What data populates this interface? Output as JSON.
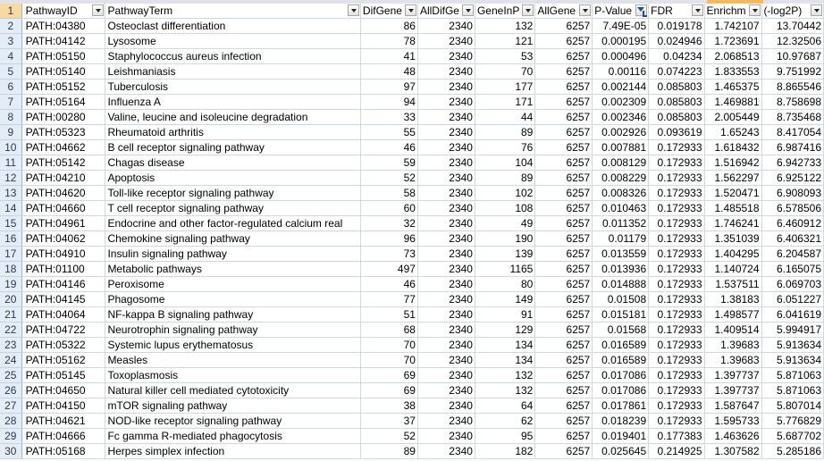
{
  "headers": [
    {
      "label": "PathwayID",
      "filtered": false
    },
    {
      "label": "PathwayTerm",
      "filtered": false
    },
    {
      "label": "DifGene",
      "filtered": false
    },
    {
      "label": "AllDifGe",
      "filtered": false
    },
    {
      "label": "GeneInP",
      "filtered": false
    },
    {
      "label": "AllGene",
      "filtered": false
    },
    {
      "label": "P-Value",
      "filtered": true
    },
    {
      "label": "FDR",
      "filtered": false
    },
    {
      "label": "Enrichm",
      "filtered": false
    },
    {
      "label": "(-log2P)",
      "filtered": false
    }
  ],
  "rows": [
    {
      "n": "2",
      "c": [
        "PATH:04380",
        "Osteoclast differentiation",
        "86",
        "2340",
        "132",
        "6257",
        "7.49E-05",
        "0.019178",
        "1.742107",
        "13.70442"
      ]
    },
    {
      "n": "3",
      "c": [
        "PATH:04142",
        "Lysosome",
        "78",
        "2340",
        "121",
        "6257",
        "0.000195",
        "0.024946",
        "1.723691",
        "12.32506"
      ]
    },
    {
      "n": "4",
      "c": [
        "PATH:05150",
        "Staphylococcus aureus infection",
        "41",
        "2340",
        "53",
        "6257",
        "0.000496",
        "0.04234",
        "2.068513",
        "10.97687"
      ]
    },
    {
      "n": "5",
      "c": [
        "PATH:05140",
        "Leishmaniasis",
        "48",
        "2340",
        "70",
        "6257",
        "0.00116",
        "0.074223",
        "1.833553",
        "9.751992"
      ]
    },
    {
      "n": "6",
      "c": [
        "PATH:05152",
        "Tuberculosis",
        "97",
        "2340",
        "177",
        "6257",
        "0.002144",
        "0.085803",
        "1.465375",
        "8.865546"
      ]
    },
    {
      "n": "7",
      "c": [
        "PATH:05164",
        "Influenza A",
        "94",
        "2340",
        "171",
        "6257",
        "0.002309",
        "0.085803",
        "1.469881",
        "8.758698"
      ]
    },
    {
      "n": "8",
      "c": [
        "PATH:00280",
        "Valine, leucine and isoleucine degradation",
        "33",
        "2340",
        "44",
        "6257",
        "0.002346",
        "0.085803",
        "2.005449",
        "8.735468"
      ]
    },
    {
      "n": "9",
      "c": [
        "PATH:05323",
        "Rheumatoid arthritis",
        "55",
        "2340",
        "89",
        "6257",
        "0.002926",
        "0.093619",
        "1.65243",
        "8.417054"
      ]
    },
    {
      "n": "10",
      "c": [
        "PATH:04662",
        "B cell receptor signaling pathway",
        "46",
        "2340",
        "76",
        "6257",
        "0.007881",
        "0.172933",
        "1.618432",
        "6.987416"
      ]
    },
    {
      "n": "11",
      "c": [
        "PATH:05142",
        "Chagas disease",
        "59",
        "2340",
        "104",
        "6257",
        "0.008129",
        "0.172933",
        "1.516942",
        "6.942733"
      ]
    },
    {
      "n": "12",
      "c": [
        "PATH:04210",
        "Apoptosis",
        "52",
        "2340",
        "89",
        "6257",
        "0.008229",
        "0.172933",
        "1.562297",
        "6.925122"
      ]
    },
    {
      "n": "13",
      "c": [
        "PATH:04620",
        "Toll-like receptor signaling pathway",
        "58",
        "2340",
        "102",
        "6257",
        "0.008326",
        "0.172933",
        "1.520471",
        "6.908093"
      ]
    },
    {
      "n": "14",
      "c": [
        "PATH:04660",
        "T cell receptor signaling pathway",
        "60",
        "2340",
        "108",
        "6257",
        "0.010463",
        "0.172933",
        "1.485518",
        "6.578506"
      ]
    },
    {
      "n": "15",
      "c": [
        "PATH:04961",
        "Endocrine and other factor-regulated calcium real",
        "32",
        "2340",
        "49",
        "6257",
        "0.011352",
        "0.172933",
        "1.746241",
        "6.460912"
      ]
    },
    {
      "n": "16",
      "c": [
        "PATH:04062",
        "Chemokine signaling pathway",
        "96",
        "2340",
        "190",
        "6257",
        "0.01179",
        "0.172933",
        "1.351039",
        "6.406321"
      ]
    },
    {
      "n": "17",
      "c": [
        "PATH:04910",
        "Insulin signaling pathway",
        "73",
        "2340",
        "139",
        "6257",
        "0.013559",
        "0.172933",
        "1.404295",
        "6.204587"
      ]
    },
    {
      "n": "18",
      "c": [
        "PATH:01100",
        "Metabolic pathways",
        "497",
        "2340",
        "1165",
        "6257",
        "0.013936",
        "0.172933",
        "1.140724",
        "6.165075"
      ]
    },
    {
      "n": "19",
      "c": [
        "PATH:04146",
        "Peroxisome",
        "46",
        "2340",
        "80",
        "6257",
        "0.014888",
        "0.172933",
        "1.537511",
        "6.069703"
      ]
    },
    {
      "n": "20",
      "c": [
        "PATH:04145",
        "Phagosome",
        "77",
        "2340",
        "149",
        "6257",
        "0.01508",
        "0.172933",
        "1.38183",
        "6.051227"
      ]
    },
    {
      "n": "21",
      "c": [
        "PATH:04064",
        "NF-kappa B signaling pathway",
        "51",
        "2340",
        "91",
        "6257",
        "0.015181",
        "0.172933",
        "1.498577",
        "6.041619"
      ]
    },
    {
      "n": "22",
      "c": [
        "PATH:04722",
        "Neurotrophin signaling pathway",
        "68",
        "2340",
        "129",
        "6257",
        "0.01568",
        "0.172933",
        "1.409514",
        "5.994917"
      ]
    },
    {
      "n": "23",
      "c": [
        "PATH:05322",
        "Systemic lupus erythematosus",
        "70",
        "2340",
        "134",
        "6257",
        "0.016589",
        "0.172933",
        "1.39683",
        "5.913634"
      ]
    },
    {
      "n": "24",
      "c": [
        "PATH:05162",
        "Measles",
        "70",
        "2340",
        "134",
        "6257",
        "0.016589",
        "0.172933",
        "1.39683",
        "5.913634"
      ]
    },
    {
      "n": "25",
      "c": [
        "PATH:05145",
        "Toxoplasmosis",
        "69",
        "2340",
        "132",
        "6257",
        "0.017086",
        "0.172933",
        "1.397737",
        "5.871063"
      ]
    },
    {
      "n": "26",
      "c": [
        "PATH:04650",
        "Natural killer cell mediated cytotoxicity",
        "69",
        "2340",
        "132",
        "6257",
        "0.017086",
        "0.172933",
        "1.397737",
        "5.871063"
      ]
    },
    {
      "n": "27",
      "c": [
        "PATH:04150",
        "mTOR signaling pathway",
        "38",
        "2340",
        "64",
        "6257",
        "0.017861",
        "0.172933",
        "1.587647",
        "5.807014"
      ]
    },
    {
      "n": "28",
      "c": [
        "PATH:04621",
        "NOD-like receptor signaling pathway",
        "37",
        "2340",
        "62",
        "6257",
        "0.018239",
        "0.172933",
        "1.595733",
        "5.776829"
      ]
    },
    {
      "n": "29",
      "c": [
        "PATH:04666",
        "Fc gamma R-mediated phagocytosis",
        "52",
        "2340",
        "95",
        "6257",
        "0.019401",
        "0.177383",
        "1.463626",
        "5.687702"
      ]
    },
    {
      "n": "30",
      "c": [
        "PATH:05168",
        "Herpes simplex infection",
        "89",
        "2340",
        "182",
        "6257",
        "0.025645",
        "0.214925",
        "1.307582",
        "5.285186"
      ]
    }
  ]
}
